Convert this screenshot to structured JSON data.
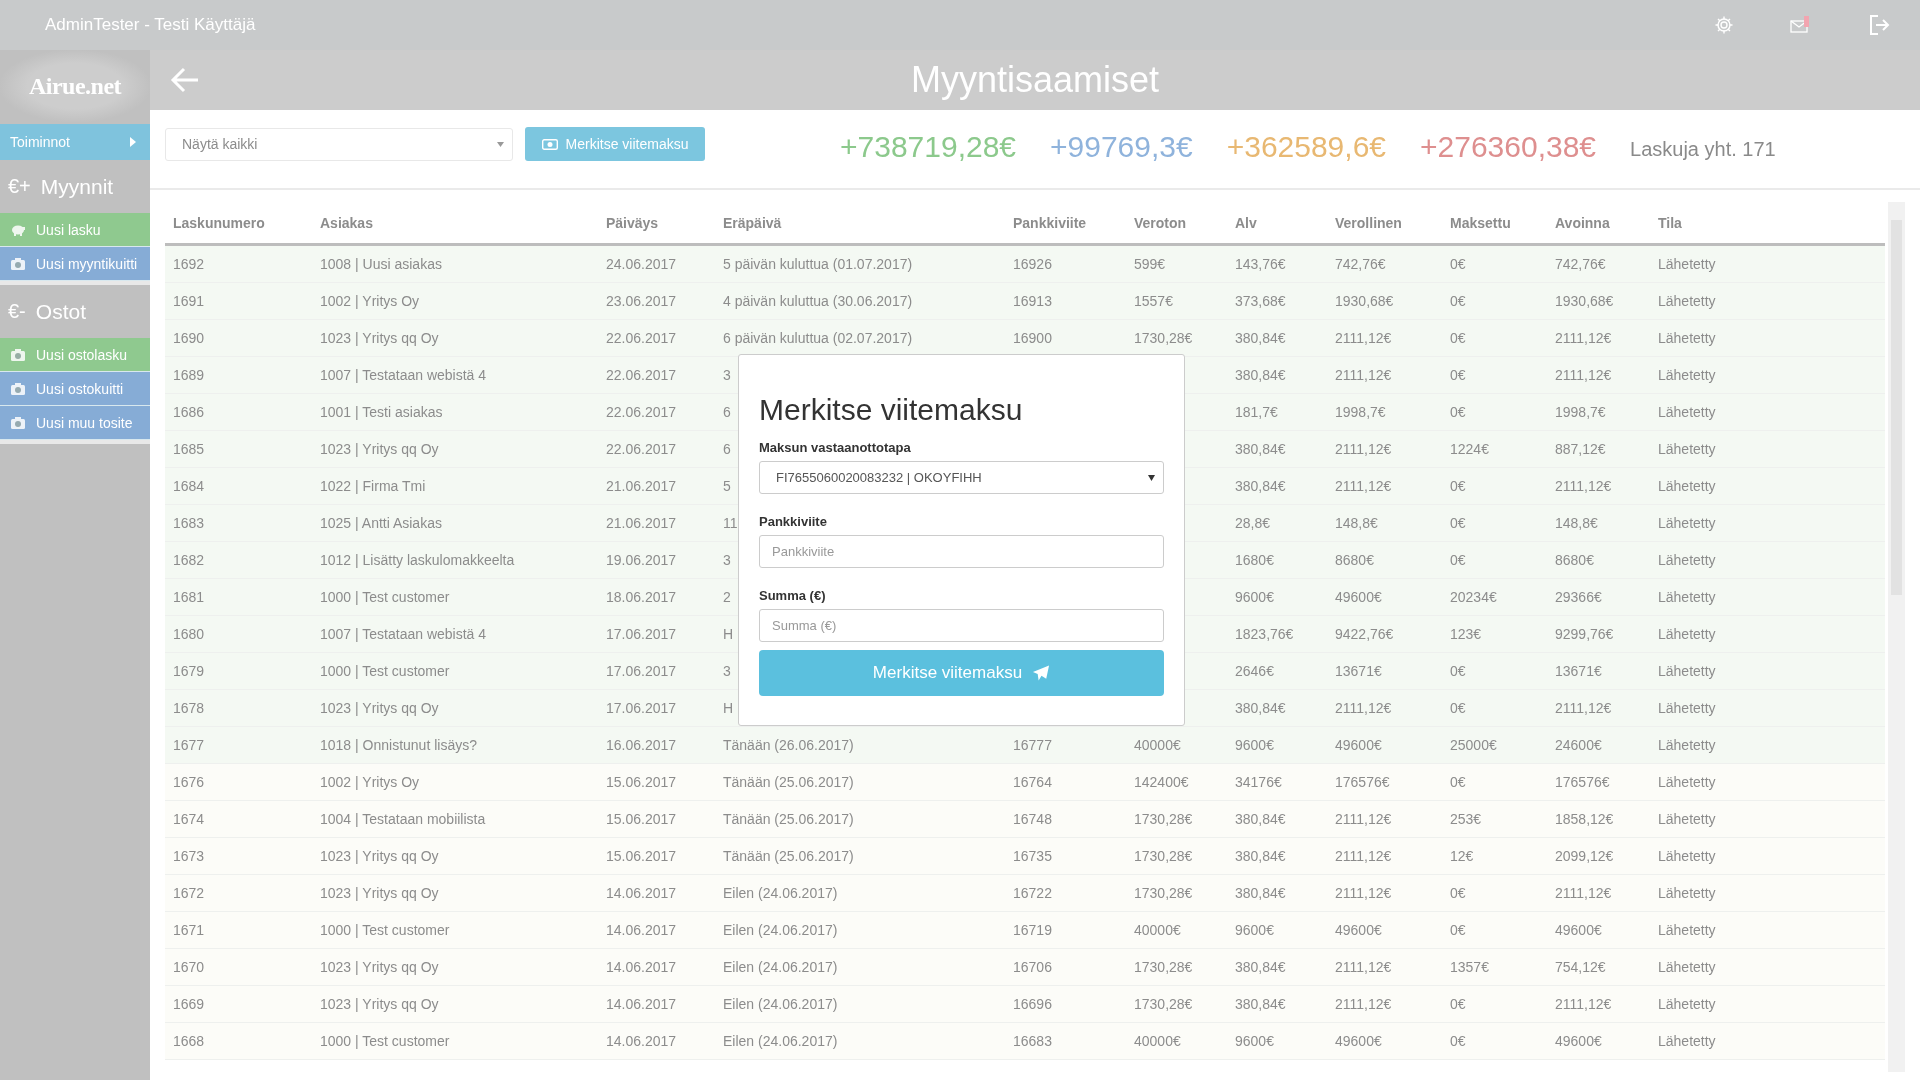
{
  "topbar": {
    "user": "AdminTester - Testi Käyttäjä",
    "mail_alert": true
  },
  "sidebar": {
    "logo": "Airue.net",
    "menu": {
      "label": "Toiminnot"
    },
    "sections": [
      {
        "prefix": "€+",
        "title": "Myynnit",
        "items": [
          {
            "label": "Uusi lasku",
            "color": "#8fc98f"
          },
          {
            "label": "Uusi myyntikuitti",
            "color": "#86acd6"
          }
        ]
      },
      {
        "prefix": "€-",
        "title": "Ostot",
        "items": [
          {
            "label": "Uusi ostolasku",
            "color": "#8fc98f"
          },
          {
            "label": "Uusi ostokuitti",
            "color": "#86acd6"
          },
          {
            "label": "Uusi muu tosite",
            "color": "#86acd6"
          }
        ]
      }
    ]
  },
  "header": {
    "title": "Myyntisaamiset"
  },
  "toolbar": {
    "filter": {
      "value": "Näytä kaikki"
    },
    "button": "Merkitse viitemaksu",
    "totals": [
      {
        "text": "+738719,28€",
        "color": "#8cc98c"
      },
      {
        "text": "+99769,3€",
        "color": "#8fb3dc"
      },
      {
        "text": "+362589,6€",
        "color": "#e8b872"
      },
      {
        "text": "+276360,38€",
        "color": "#de8f8f"
      }
    ],
    "count": "Laskuja yht. 171"
  },
  "table": {
    "columns": [
      "Laskunumero",
      "Asiakas",
      "Päiväys",
      "Eräpäivä",
      "Pankkiviite",
      "Veroton",
      "Alv",
      "Verollinen",
      "Maksettu",
      "Avoinna",
      "Tila"
    ],
    "rows": [
      {
        "color": "#f4f9f3",
        "number": "1692",
        "customer": "1008 | Uusi asiakas",
        "date": "24.06.2017",
        "due": "5 päivän kuluttua (01.07.2017)",
        "reference": "16926",
        "net": "599€",
        "vat": "143,76€",
        "gross": "742,76€",
        "paid": "0€",
        "open": "742,76€",
        "status": "Lähetetty"
      },
      {
        "color": "#f4f9f3",
        "number": "1691",
        "customer": "1002 | Yritys Oy",
        "date": "23.06.2017",
        "due": "4 päivän kuluttua (30.06.2017)",
        "reference": "16913",
        "net": "1557€",
        "vat": "373,68€",
        "gross": "1930,68€",
        "paid": "0€",
        "open": "1930,68€",
        "status": "Lähetetty"
      },
      {
        "color": "#f4f9f3",
        "number": "1690",
        "customer": "1023 | Yritys qq Oy",
        "date": "22.06.2017",
        "due": "6 päivän kuluttua (02.07.2017)",
        "reference": "16900",
        "net": "1730,28€",
        "vat": "380,84€",
        "gross": "2111,12€",
        "paid": "0€",
        "open": "2111,12€",
        "status": "Lähetetty"
      },
      {
        "color": "#f4f9f3",
        "number": "1689",
        "customer": "1007 | Testataan webistä 4",
        "date": "22.06.2017",
        "due": "3",
        "vat": "380,84€",
        "gross": "2111,12€",
        "paid": "0€",
        "open": "2111,12€",
        "status": "Lähetetty"
      },
      {
        "color": "#f4f9f3",
        "number": "1686",
        "customer": "1001 | Testi asiakas",
        "date": "22.06.2017",
        "due": "6",
        "vat": "181,7€",
        "gross": "1998,7€",
        "paid": "0€",
        "open": "1998,7€",
        "status": "Lähetetty"
      },
      {
        "color": "#f4f9f3",
        "number": "1685",
        "customer": "1023 | Yritys qq Oy",
        "date": "22.06.2017",
        "due": "6",
        "vat": "380,84€",
        "gross": "2111,12€",
        "paid": "1224€",
        "open": "887,12€",
        "status": "Lähetetty"
      },
      {
        "color": "#f4f9f3",
        "number": "1684",
        "customer": "1022 | Firma Tmi",
        "date": "21.06.2017",
        "due": "5",
        "vat": "380,84€",
        "gross": "2111,12€",
        "paid": "0€",
        "open": "2111,12€",
        "status": "Lähetetty"
      },
      {
        "color": "#f4f9f3",
        "number": "1683",
        "customer": "1025 | Antti Asiakas",
        "date": "21.06.2017",
        "due": "11",
        "vat": "28,8€",
        "gross": "148,8€",
        "paid": "0€",
        "open": "148,8€",
        "status": "Lähetetty"
      },
      {
        "color": "#f4f9f3",
        "number": "1682",
        "customer": "1012 | Lisätty laskulomakkeelta",
        "date": "19.06.2017",
        "due": "3",
        "vat": "1680€",
        "gross": "8680€",
        "paid": "0€",
        "open": "8680€",
        "status": "Lähetetty"
      },
      {
        "color": "#f4f9f3",
        "number": "1681",
        "customer": "1000 | Test customer",
        "date": "18.06.2017",
        "due": "2",
        "vat": "9600€",
        "gross": "49600€",
        "paid": "20234€",
        "open": "29366€",
        "status": "Lähetetty"
      },
      {
        "color": "#f4f9f3",
        "number": "1680",
        "customer": "1007 | Testataan webistä 4",
        "date": "17.06.2017",
        "due": "H",
        "vat": "1823,76€",
        "gross": "9422,76€",
        "paid": "123€",
        "open": "9299,76€",
        "status": "Lähetetty"
      },
      {
        "color": "#f4f9f3",
        "number": "1679",
        "customer": "1000 | Test customer",
        "date": "17.06.2017",
        "due": "3",
        "vat": "2646€",
        "gross": "13671€",
        "paid": "0€",
        "open": "13671€",
        "status": "Lähetetty"
      },
      {
        "color": "#f4f9f3",
        "number": "1678",
        "customer": "1023 | Yritys qq Oy",
        "date": "17.06.2017",
        "due": "H",
        "vat": "380,84€",
        "gross": "2111,12€",
        "paid": "0€",
        "open": "2111,12€",
        "status": "Lähetetty"
      },
      {
        "color": "#f4f9f3",
        "number": "1677",
        "customer": "1018 | Onnistunut lisäys?",
        "date": "16.06.2017",
        "due": "Tänään (26.06.2017)",
        "reference": "16777",
        "net": "40000€",
        "vat": "9600€",
        "gross": "49600€",
        "paid": "25000€",
        "open": "24600€",
        "status": "Lähetetty"
      },
      {
        "color": "#fcfcf8",
        "number": "1676",
        "customer": "1002 | Yritys Oy",
        "date": "15.06.2017",
        "due": "Tänään (25.06.2017)",
        "reference": "16764",
        "net": "142400€",
        "vat": "34176€",
        "gross": "176576€",
        "paid": "0€",
        "open": "176576€",
        "status": "Lähetetty"
      },
      {
        "color": "#fcfcf8",
        "number": "1674",
        "customer": "1004 | Testataan mobiilista",
        "date": "15.06.2017",
        "due": "Tänään (25.06.2017)",
        "reference": "16748",
        "net": "1730,28€",
        "vat": "380,84€",
        "gross": "2111,12€",
        "paid": "253€",
        "open": "1858,12€",
        "status": "Lähetetty"
      },
      {
        "color": "#fcfcf8",
        "number": "1673",
        "customer": "1023 | Yritys qq Oy",
        "date": "15.06.2017",
        "due": "Tänään (25.06.2017)",
        "reference": "16735",
        "net": "1730,28€",
        "vat": "380,84€",
        "gross": "2111,12€",
        "paid": "12€",
        "open": "2099,12€",
        "status": "Lähetetty"
      },
      {
        "color": "#fcfcf8",
        "number": "1672",
        "customer": "1023 | Yritys qq Oy",
        "date": "14.06.2017",
        "due": "Eilen (24.06.2017)",
        "reference": "16722",
        "net": "1730,28€",
        "vat": "380,84€",
        "gross": "2111,12€",
        "paid": "0€",
        "open": "2111,12€",
        "status": "Lähetetty"
      },
      {
        "color": "#fcfcf8",
        "number": "1671",
        "customer": "1000 | Test customer",
        "date": "14.06.2017",
        "due": "Eilen (24.06.2017)",
        "reference": "16719",
        "net": "40000€",
        "vat": "9600€",
        "gross": "49600€",
        "paid": "0€",
        "open": "49600€",
        "status": "Lähetetty"
      },
      {
        "color": "#fcfcf8",
        "number": "1670",
        "customer": "1023 | Yritys qq Oy",
        "date": "14.06.2017",
        "due": "Eilen (24.06.2017)",
        "reference": "16706",
        "net": "1730,28€",
        "vat": "380,84€",
        "gross": "2111,12€",
        "paid": "1357€",
        "open": "754,12€",
        "status": "Lähetetty"
      },
      {
        "color": "#fcfcf8",
        "number": "1669",
        "customer": "1023 | Yritys qq Oy",
        "date": "14.06.2017",
        "due": "Eilen (24.06.2017)",
        "reference": "16696",
        "net": "1730,28€",
        "vat": "380,84€",
        "gross": "2111,12€",
        "paid": "0€",
        "open": "2111,12€",
        "status": "Lähetetty"
      },
      {
        "color": "#fcfcf8",
        "number": "1668",
        "customer": "1000 | Test customer",
        "date": "14.06.2017",
        "due": "Eilen (24.06.2017)",
        "reference": "16683",
        "net": "40000€",
        "vat": "9600€",
        "gross": "49600€",
        "paid": "0€",
        "open": "49600€",
        "status": "Lähetetty"
      }
    ]
  },
  "modal": {
    "title": "Merkitse viitemaksu",
    "fields": [
      {
        "kind": "select",
        "label": "Maksun vastaanottotapa",
        "value": "FI7655060020083232 | OKOYFIHH"
      },
      {
        "kind": "input",
        "label": "Pankkiviite",
        "placeholder": "Pankkiviite"
      },
      {
        "kind": "input",
        "label": "Summa (€)",
        "placeholder": "Summa (€)"
      }
    ],
    "submit": "Merkitse viitemaksu"
  }
}
